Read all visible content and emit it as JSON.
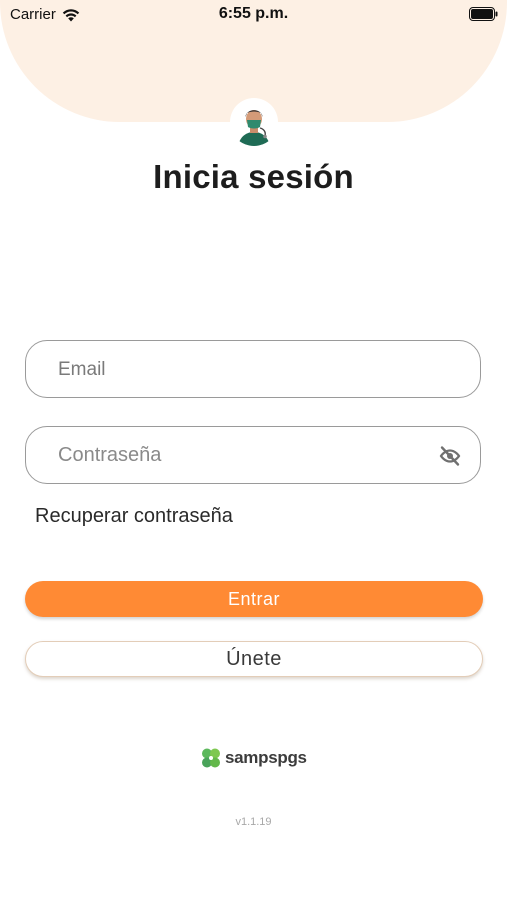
{
  "status_bar": {
    "carrier": "Carrier",
    "time": "6:55 p.m.",
    "icons": [
      "wifi-icon",
      "battery-icon"
    ]
  },
  "header": {
    "avatar_icon": "doctor-avatar-icon",
    "title": "Inicia sesión"
  },
  "form": {
    "email_placeholder": "Email",
    "password_placeholder": "Contraseña",
    "password_toggle_icon": "eye-off-icon",
    "recover_label": "Recuperar contraseña"
  },
  "actions": {
    "primary_label": "Entrar",
    "secondary_label": "Únete"
  },
  "footer": {
    "brand_name": "sampspgs",
    "version": "v1.1.19"
  },
  "colors": {
    "header_bg": "#fdf0e4",
    "accent": "#ff8a34",
    "brand_green": "#5cb85c"
  }
}
